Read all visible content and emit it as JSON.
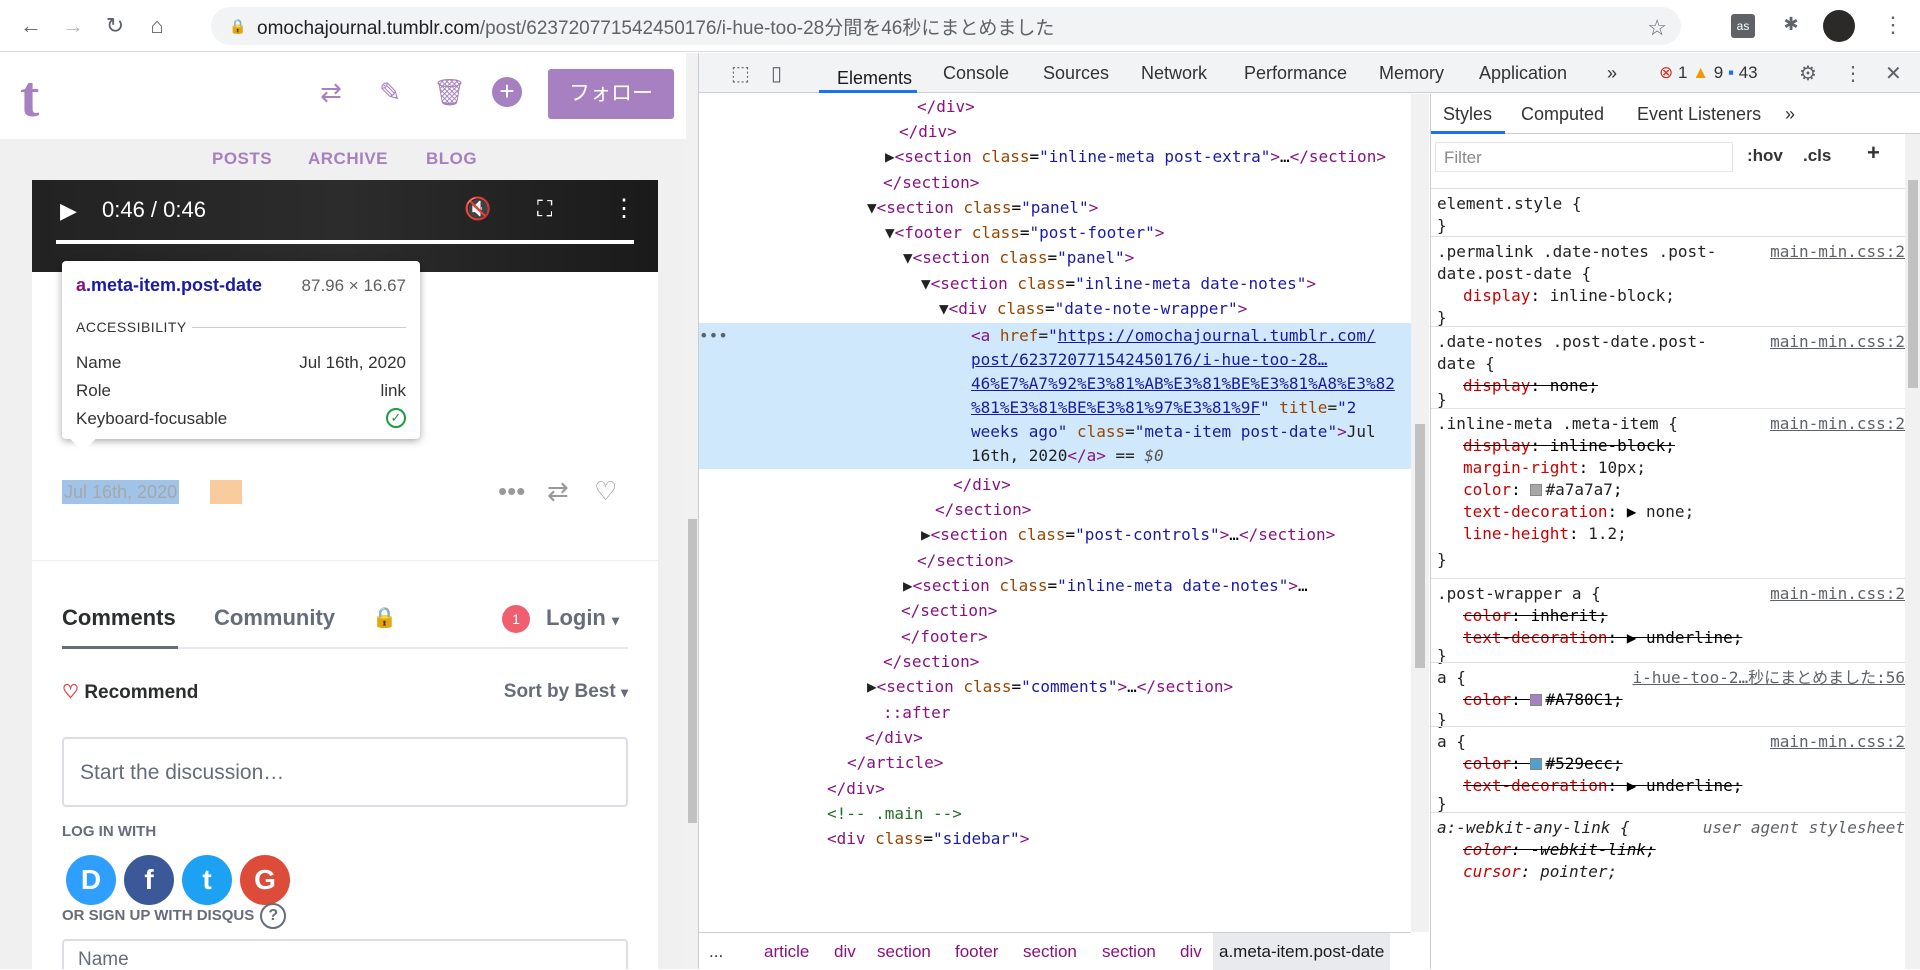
{
  "browser": {
    "url_host": "omochajournal.tumblr.com",
    "url_path": "/post/623720771542450176/i-hue-too-28分間を46秒にまとめました"
  },
  "tumblr": {
    "follow_label": "フォロー",
    "nav": [
      "POSTS",
      "ARCHIVE",
      "BLOG"
    ]
  },
  "video": {
    "time": "0:46 / 0:46",
    "progress": 1.0
  },
  "post": {
    "date": "Jul 16th, 2020"
  },
  "tooltip": {
    "selector_tag": "a",
    "selector_class": ".meta-item.post-date",
    "dimensions": "87.96 × 16.67",
    "section": "ACCESSIBILITY",
    "rows": [
      {
        "label": "Name",
        "value": "Jul 16th, 2020"
      },
      {
        "label": "Role",
        "value": "link"
      },
      {
        "label": "Keyboard-focusable",
        "value": ""
      }
    ]
  },
  "disqus": {
    "tab_comments": "Comments",
    "tab_community": "Community",
    "badge": "1",
    "login": "Login",
    "recommend": "Recommend",
    "sort": "Sort by Best",
    "placeholder": "Start the discussion…",
    "log_in_with": "LOG IN WITH",
    "social": [
      "D",
      "f",
      "t",
      "G"
    ],
    "signup": "OR SIGN UP WITH DISQUS",
    "name_placeholder": "Name"
  },
  "devtools": {
    "tabs": [
      "Elements",
      "Console",
      "Sources",
      "Network",
      "Performance",
      "Memory",
      "Application"
    ],
    "errors": "1",
    "warnings": "9",
    "messages": "43",
    "breadcrumbs": [
      "...",
      "article",
      "div",
      "section",
      "footer",
      "section",
      "section",
      "div",
      "a.meta-item.post-date"
    ],
    "styles_tabs": [
      "Styles",
      "Computed",
      "Event Listeners"
    ],
    "filter_placeholder": "Filter",
    "hov": ":hov",
    "cls": ".cls"
  },
  "colors": {
    "tumblr_accent": "#a780c1",
    "meta_color": "#a7a7a7",
    "link_color": "#529ecc"
  }
}
